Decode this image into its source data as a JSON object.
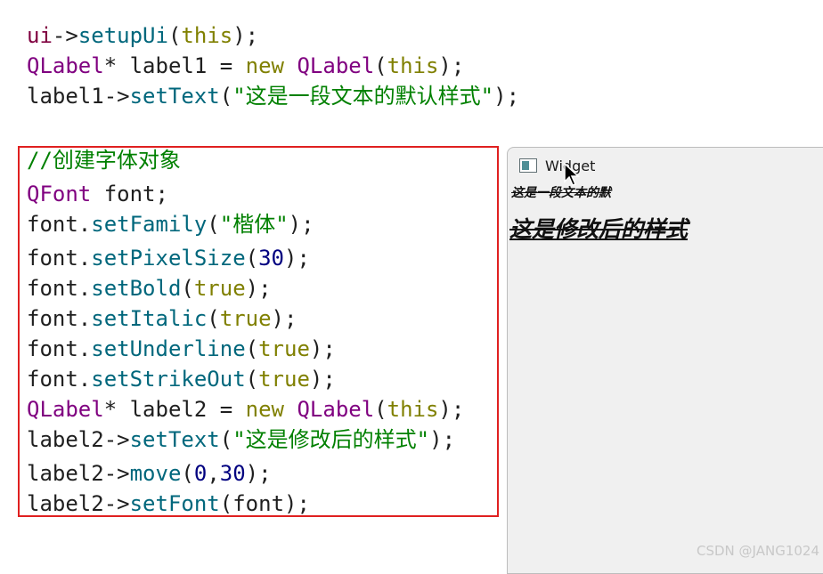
{
  "code": {
    "line1": [
      {
        "t": "ui",
        "k": "var"
      },
      {
        "t": "->",
        "k": "op"
      },
      {
        "t": "setupUi",
        "k": "fn"
      },
      {
        "t": "(",
        "k": "op"
      },
      {
        "t": "this",
        "k": "kw"
      },
      {
        "t": ");",
        "k": "op"
      }
    ],
    "line2": [
      {
        "t": "QLabel",
        "k": "type"
      },
      {
        "t": "* label1 = ",
        "k": "plain"
      },
      {
        "t": "new",
        "k": "kw"
      },
      {
        "t": " ",
        "k": "plain"
      },
      {
        "t": "QLabel",
        "k": "type"
      },
      {
        "t": "(",
        "k": "op"
      },
      {
        "t": "this",
        "k": "kw"
      },
      {
        "t": ");",
        "k": "op"
      }
    ],
    "line3": [
      {
        "t": "label1",
        "k": "plain"
      },
      {
        "t": "->",
        "k": "op"
      },
      {
        "t": "setText",
        "k": "fn"
      },
      {
        "t": "(",
        "k": "op"
      },
      {
        "t": "\"这是一段文本的默认样式\"",
        "k": "str"
      },
      {
        "t": ");",
        "k": "op"
      }
    ],
    "boxed": [
      [
        {
          "t": "//创建字体对象",
          "k": "comment"
        }
      ],
      [
        {
          "t": "QFont",
          "k": "type"
        },
        {
          "t": " font;",
          "k": "plain"
        }
      ],
      [
        {
          "t": "font.",
          "k": "plain"
        },
        {
          "t": "setFamily",
          "k": "fn"
        },
        {
          "t": "(",
          "k": "op"
        },
        {
          "t": "\"楷体\"",
          "k": "str"
        },
        {
          "t": ");",
          "k": "op"
        }
      ],
      [
        {
          "t": "font.",
          "k": "plain"
        },
        {
          "t": "setPixelSize",
          "k": "fn"
        },
        {
          "t": "(",
          "k": "op"
        },
        {
          "t": "30",
          "k": "num"
        },
        {
          "t": ");",
          "k": "op"
        }
      ],
      [
        {
          "t": "font.",
          "k": "plain"
        },
        {
          "t": "setBold",
          "k": "fn"
        },
        {
          "t": "(",
          "k": "op"
        },
        {
          "t": "true",
          "k": "kw"
        },
        {
          "t": ");",
          "k": "op"
        }
      ],
      [
        {
          "t": "font.",
          "k": "plain"
        },
        {
          "t": "setItalic",
          "k": "fn"
        },
        {
          "t": "(",
          "k": "op"
        },
        {
          "t": "true",
          "k": "kw"
        },
        {
          "t": ");",
          "k": "op"
        }
      ],
      [
        {
          "t": "font.",
          "k": "plain"
        },
        {
          "t": "setUnderline",
          "k": "fn"
        },
        {
          "t": "(",
          "k": "op"
        },
        {
          "t": "true",
          "k": "kw"
        },
        {
          "t": ");",
          "k": "op"
        }
      ],
      [
        {
          "t": "font.",
          "k": "plain"
        },
        {
          "t": "setStrikeOut",
          "k": "fn"
        },
        {
          "t": "(",
          "k": "op"
        },
        {
          "t": "true",
          "k": "kw"
        },
        {
          "t": ");",
          "k": "op"
        }
      ],
      [
        {
          "t": "QLabel",
          "k": "type"
        },
        {
          "t": "* label2 = ",
          "k": "plain"
        },
        {
          "t": "new",
          "k": "kw"
        },
        {
          "t": " ",
          "k": "plain"
        },
        {
          "t": "QLabel",
          "k": "type"
        },
        {
          "t": "(",
          "k": "op"
        },
        {
          "t": "this",
          "k": "kw"
        },
        {
          "t": ");",
          "k": "op"
        }
      ],
      [
        {
          "t": "label2",
          "k": "plain"
        },
        {
          "t": "->",
          "k": "op"
        },
        {
          "t": "setText",
          "k": "fn"
        },
        {
          "t": "(",
          "k": "op"
        },
        {
          "t": "\"这是修改后的样式\"",
          "k": "str"
        },
        {
          "t": ");",
          "k": "op"
        }
      ],
      [
        {
          "t": "label2",
          "k": "plain"
        },
        {
          "t": "->",
          "k": "op"
        },
        {
          "t": "move",
          "k": "fn"
        },
        {
          "t": "(",
          "k": "op"
        },
        {
          "t": "0",
          "k": "num"
        },
        {
          "t": ",",
          "k": "op"
        },
        {
          "t": "30",
          "k": "num"
        },
        {
          "t": ");",
          "k": "op"
        }
      ],
      [
        {
          "t": "label2",
          "k": "plain"
        },
        {
          "t": "->",
          "k": "op"
        },
        {
          "t": "setFont",
          "k": "fn"
        },
        {
          "t": "(",
          "k": "op"
        },
        {
          "t": "font",
          "k": "plain"
        },
        {
          "t": ");",
          "k": "op"
        }
      ]
    ]
  },
  "highlight": {
    "border_color": "#e02020"
  },
  "widget": {
    "title": "Widget",
    "label1_text": "这是一段文本的默",
    "label2_text": "这是修改后的样式",
    "icon": "window-app-icon"
  },
  "watermark": "CSDN @JANG1024"
}
